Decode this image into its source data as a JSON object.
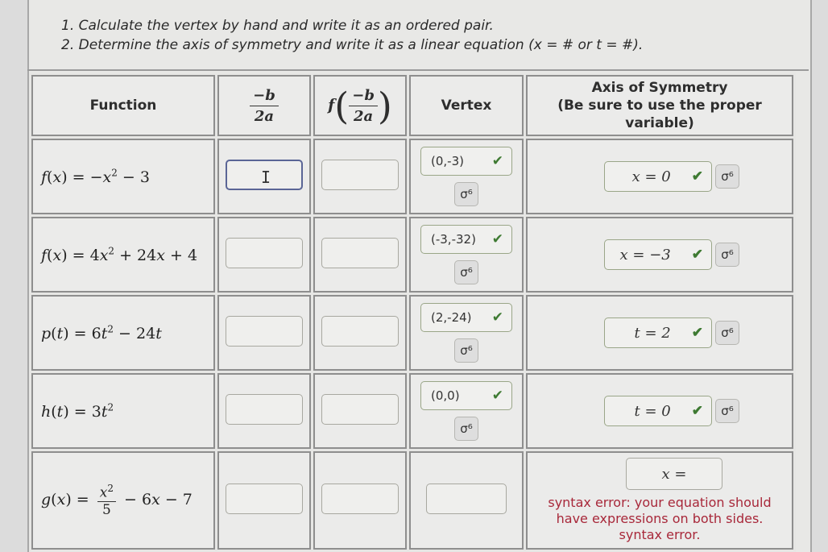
{
  "instructions": [
    "1. Calculate the vertex by hand and write it as an ordered pair.",
    "2. Determine the axis of symmetry and write it as a linear equation (x = # or t = #)."
  ],
  "table": {
    "headers": {
      "function": "Function",
      "neg_b_over_2a": {
        "num": "−b",
        "den": "2a"
      },
      "f_of": {
        "f": "f",
        "num": "−b",
        "den": "2a"
      },
      "vertex": "Vertex",
      "axis_line1": "Axis of Symmetry",
      "axis_line2": "(Be sure to use the proper",
      "axis_line3": "variable)"
    },
    "rows": [
      {
        "name": "f",
        "var": "x",
        "function_parts": {
          "lhs": "f(x) = ",
          "body": "−x² − 3"
        },
        "neg_b_over_2a": "",
        "f_value": "",
        "vertex": "(0,-3)",
        "vertex_status": "correct",
        "axis": "x = 0",
        "axis_status": "correct"
      },
      {
        "name": "f",
        "var": "x",
        "function_parts": {
          "lhs": "f(x) = ",
          "body": "4x² + 24x + 4"
        },
        "neg_b_over_2a": "",
        "f_value": "",
        "vertex": "(-3,-32)",
        "vertex_status": "correct",
        "axis": "x = −3",
        "axis_status": "correct"
      },
      {
        "name": "p",
        "var": "t",
        "function_parts": {
          "lhs": "p(t) = ",
          "body": "6t² − 24t"
        },
        "neg_b_over_2a": "",
        "f_value": "",
        "vertex": "(2,-24)",
        "vertex_status": "correct",
        "axis": "t = 2",
        "axis_status": "correct"
      },
      {
        "name": "h",
        "var": "t",
        "function_parts": {
          "lhs": "h(t) = ",
          "body": "3t²"
        },
        "neg_b_over_2a": "",
        "f_value": "",
        "vertex": "(0,0)",
        "vertex_status": "correct",
        "axis": "t = 0",
        "axis_status": "correct"
      },
      {
        "name": "g",
        "var": "x",
        "function_parts": {
          "lhs": "g(x) = ",
          "frac_num": "x²",
          "frac_den": "5",
          "rest": "− 6x − 7"
        },
        "neg_b_over_2a": "",
        "f_value": "",
        "vertex": "",
        "vertex_status": "empty",
        "axis": "x =",
        "axis_status": "error",
        "error_lines": [
          "syntax error: your equation should",
          "have expressions on both sides.",
          "syntax error."
        ]
      }
    ]
  },
  "icons": {
    "check": "✔",
    "keypad": "σ⁶",
    "ibeam": "I"
  },
  "colors": {
    "correct": "#3e7a32",
    "error": "#a8283a",
    "focus": "#5a6596"
  }
}
